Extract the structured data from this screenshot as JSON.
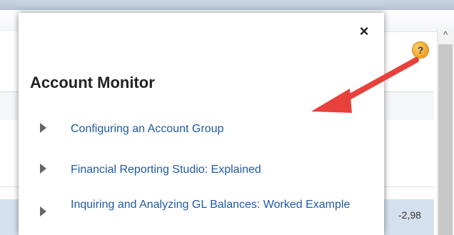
{
  "popup": {
    "title": "Account Monitor",
    "close_label": "×",
    "topics": [
      {
        "label": "Configuring an Account Group"
      },
      {
        "label": "Financial Reporting Studio: Explained"
      },
      {
        "label": "Inquiring and Analyzing GL Balances: Worked Example"
      }
    ]
  },
  "background": {
    "help_label": "?",
    "scroll_up_label": "^",
    "partial_value": "-2,98"
  },
  "colors": {
    "link": "#1f5aa6",
    "arrow": "#e8403a",
    "help_icon": "#f0a020"
  }
}
